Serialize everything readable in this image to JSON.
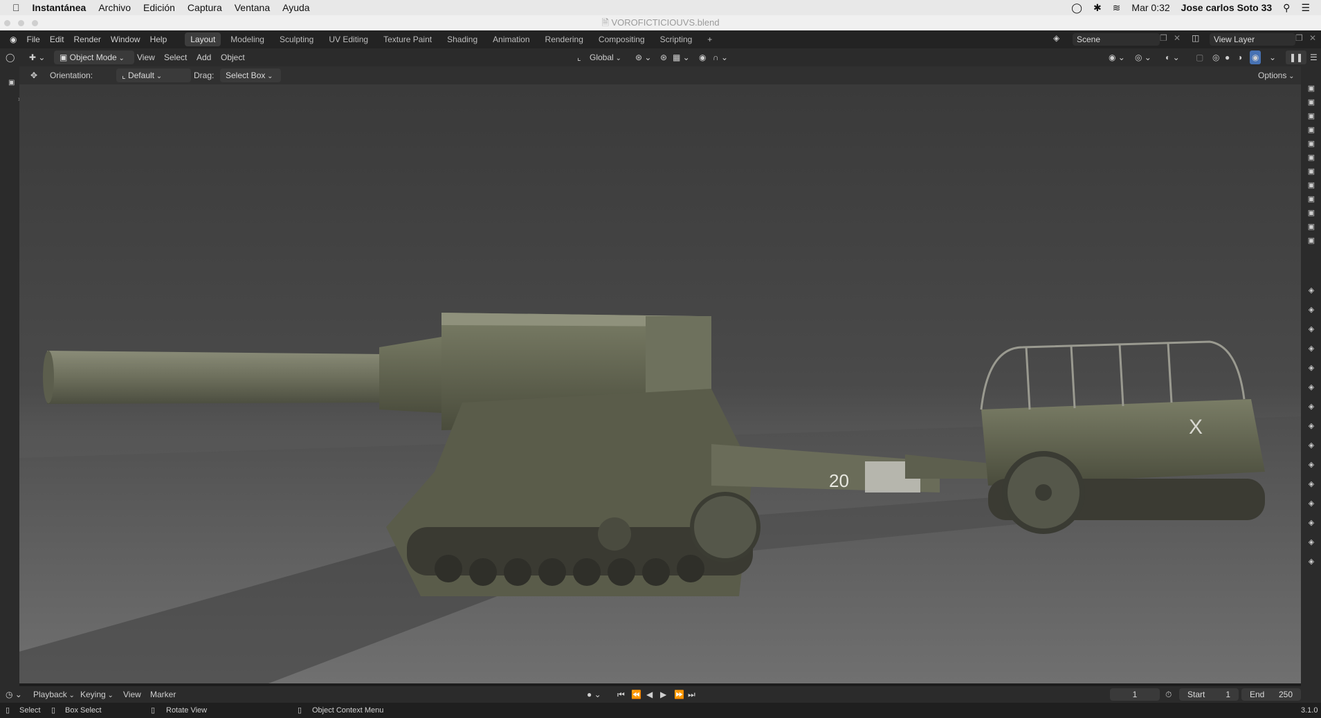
{
  "macbar": {
    "app": "Instantánea",
    "menus": [
      "Archivo",
      "Edición",
      "Captura",
      "Ventana",
      "Ayuda"
    ],
    "clock": "Mar 0:32",
    "user": "Jose carlos Soto 33"
  },
  "window": {
    "title": "VOROFICTICIOUVS.blend"
  },
  "topbar": {
    "menus": [
      "File",
      "Edit",
      "Render",
      "Window",
      "Help"
    ],
    "workspaces": [
      "Layout",
      "Modeling",
      "Sculpting",
      "UV Editing",
      "Texture Paint",
      "Shading",
      "Animation",
      "Rendering",
      "Compositing",
      "Scripting"
    ],
    "active_workspace": "Layout",
    "add_tab": "+",
    "scene": "Scene",
    "view_layer": "View Layer"
  },
  "header": {
    "mode": "Object Mode",
    "menus": [
      "View",
      "Select",
      "Add",
      "Object"
    ],
    "transform": "Global"
  },
  "tool": {
    "orientation_label": "Orientation:",
    "orientation_value": "Default",
    "drag_label": "Drag:",
    "drag_value": "Select Box",
    "options": "Options"
  },
  "timeline": {
    "menus": [
      "Playback",
      "Keying",
      "View",
      "Marker"
    ],
    "current_frame": "1",
    "start_label": "Start",
    "start_value": "1",
    "end_label": "End",
    "end_value": "250"
  },
  "status": {
    "items": [
      "Select",
      "Box Select",
      "Rotate View",
      "Object Context Menu"
    ],
    "version": "3.1.0"
  },
  "viewport": {
    "gun_number": "20"
  }
}
